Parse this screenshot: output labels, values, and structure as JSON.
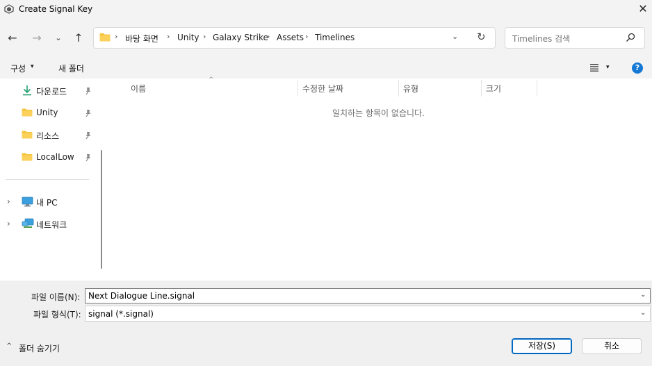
{
  "window": {
    "title": "Create Signal Key",
    "close_glyph": "✕",
    "app_icon": "unity-icon"
  },
  "nav": {
    "back_glyph": "←",
    "forward_glyph": "→",
    "recent_glyph": "⌄",
    "up_glyph": "↑"
  },
  "address": {
    "crumbs": [
      "바탕 화면",
      "Unity",
      "Galaxy Strike",
      "Assets",
      "Timelines"
    ],
    "separator": "›",
    "dropdown_glyph": "⌄",
    "refresh_glyph": "↻"
  },
  "search": {
    "placeholder": "Timelines 검색"
  },
  "toolbar": {
    "organize": "구성",
    "caret": "▾",
    "new_folder": "새 폴더",
    "help": "?"
  },
  "sidebar": {
    "quick_access": [
      {
        "label": "다운로드",
        "icon": "download-icon"
      },
      {
        "label": "Unity",
        "icon": "folder-icon"
      },
      {
        "label": "리소스",
        "icon": "folder-icon"
      },
      {
        "label": "LocalLow",
        "icon": "folder-icon"
      }
    ],
    "locations": [
      {
        "label": "내 PC",
        "icon": "pc-icon"
      },
      {
        "label": "네트워크",
        "icon": "network-icon"
      }
    ],
    "expander_glyph": "›"
  },
  "columns": {
    "name": "이름",
    "modified": "수정한 날짜",
    "type": "유형",
    "size": "크기",
    "sort_glyph": "^"
  },
  "content": {
    "empty_message": "일치하는 항목이 없습니다."
  },
  "form": {
    "filename_label": "파일 이름(N):",
    "filename_value": "Next Dialogue Line.signal",
    "filetype_label": "파일 형식(T):",
    "filetype_value": "signal (*.signal)",
    "dropdown_glyph": "⌄"
  },
  "footer": {
    "hide_caret": "^",
    "hide_folders": "폴더 숨기기",
    "save": "저장(S)",
    "cancel": "취소"
  },
  "colors": {
    "accent": "#0067c0",
    "folder_yellow": "#f5c33b",
    "download_green": "#1f9e6e"
  }
}
